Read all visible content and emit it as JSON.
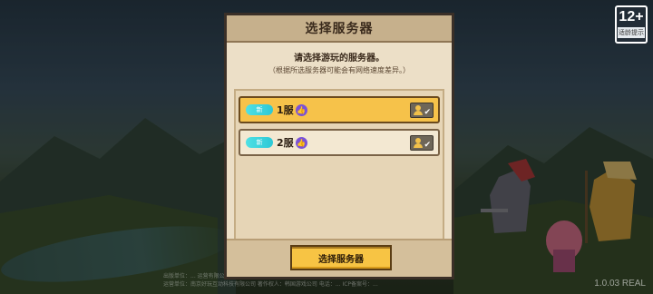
{
  "age_rating": {
    "label": "12+",
    "tip": "适龄提示"
  },
  "dialog": {
    "title": "选择服务器",
    "subtitle": "请选择游玩的服务器。",
    "note": "（根据所选服务器可能会有网络速度差异。）",
    "servers": [
      {
        "tag": "新",
        "name": "1服",
        "selected": true
      },
      {
        "tag": "新",
        "name": "2服",
        "selected": false
      }
    ],
    "confirm_label": "选择服务器"
  },
  "footer": {
    "line1": "出版单位：... 运营有限公司",
    "line2": "运营单位：南京好玩互动科技有限公司 著作权人：韩国游戏公司 电话：... ICP备案号：... ",
    "version": "1.0.03 REAL"
  },
  "icons": {
    "thumb": "thumbs-up-icon",
    "role": "character-check-icon"
  },
  "colors": {
    "selected_row": "#f6c24a",
    "new_tag": "#2cc8d6",
    "confirm_button": "#f7c444",
    "thumb_badge": "#7a52d8"
  }
}
